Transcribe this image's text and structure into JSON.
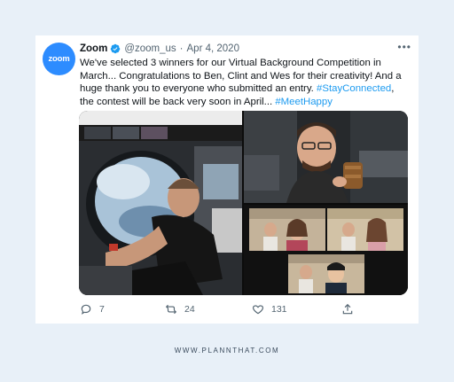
{
  "tweet": {
    "avatar_text": "zoom",
    "author_name": "Zoom",
    "handle": "@zoom_us",
    "separator": "·",
    "date": "Apr 4, 2020",
    "more_label": "•••",
    "text_part1": "We've selected 3 winners for our Virtual Background Competition in March... Congratulations to Ben, Clint and Wes for their creativity! And a huge thank you to everyone who submitted an entry. ",
    "hashtag1": "#StayConnected",
    "text_part2": ", the contest will be back very soon in April... ",
    "hashtag2": "#MeetHappy",
    "replies": "7",
    "retweets": "24",
    "likes": "131"
  },
  "footer": {
    "text": "WWW.PLANNTHAT.COM"
  },
  "colors": {
    "accent": "#1d9bf0",
    "zoom_brand": "#2d8cff",
    "page_background": "#e8f0f8"
  }
}
